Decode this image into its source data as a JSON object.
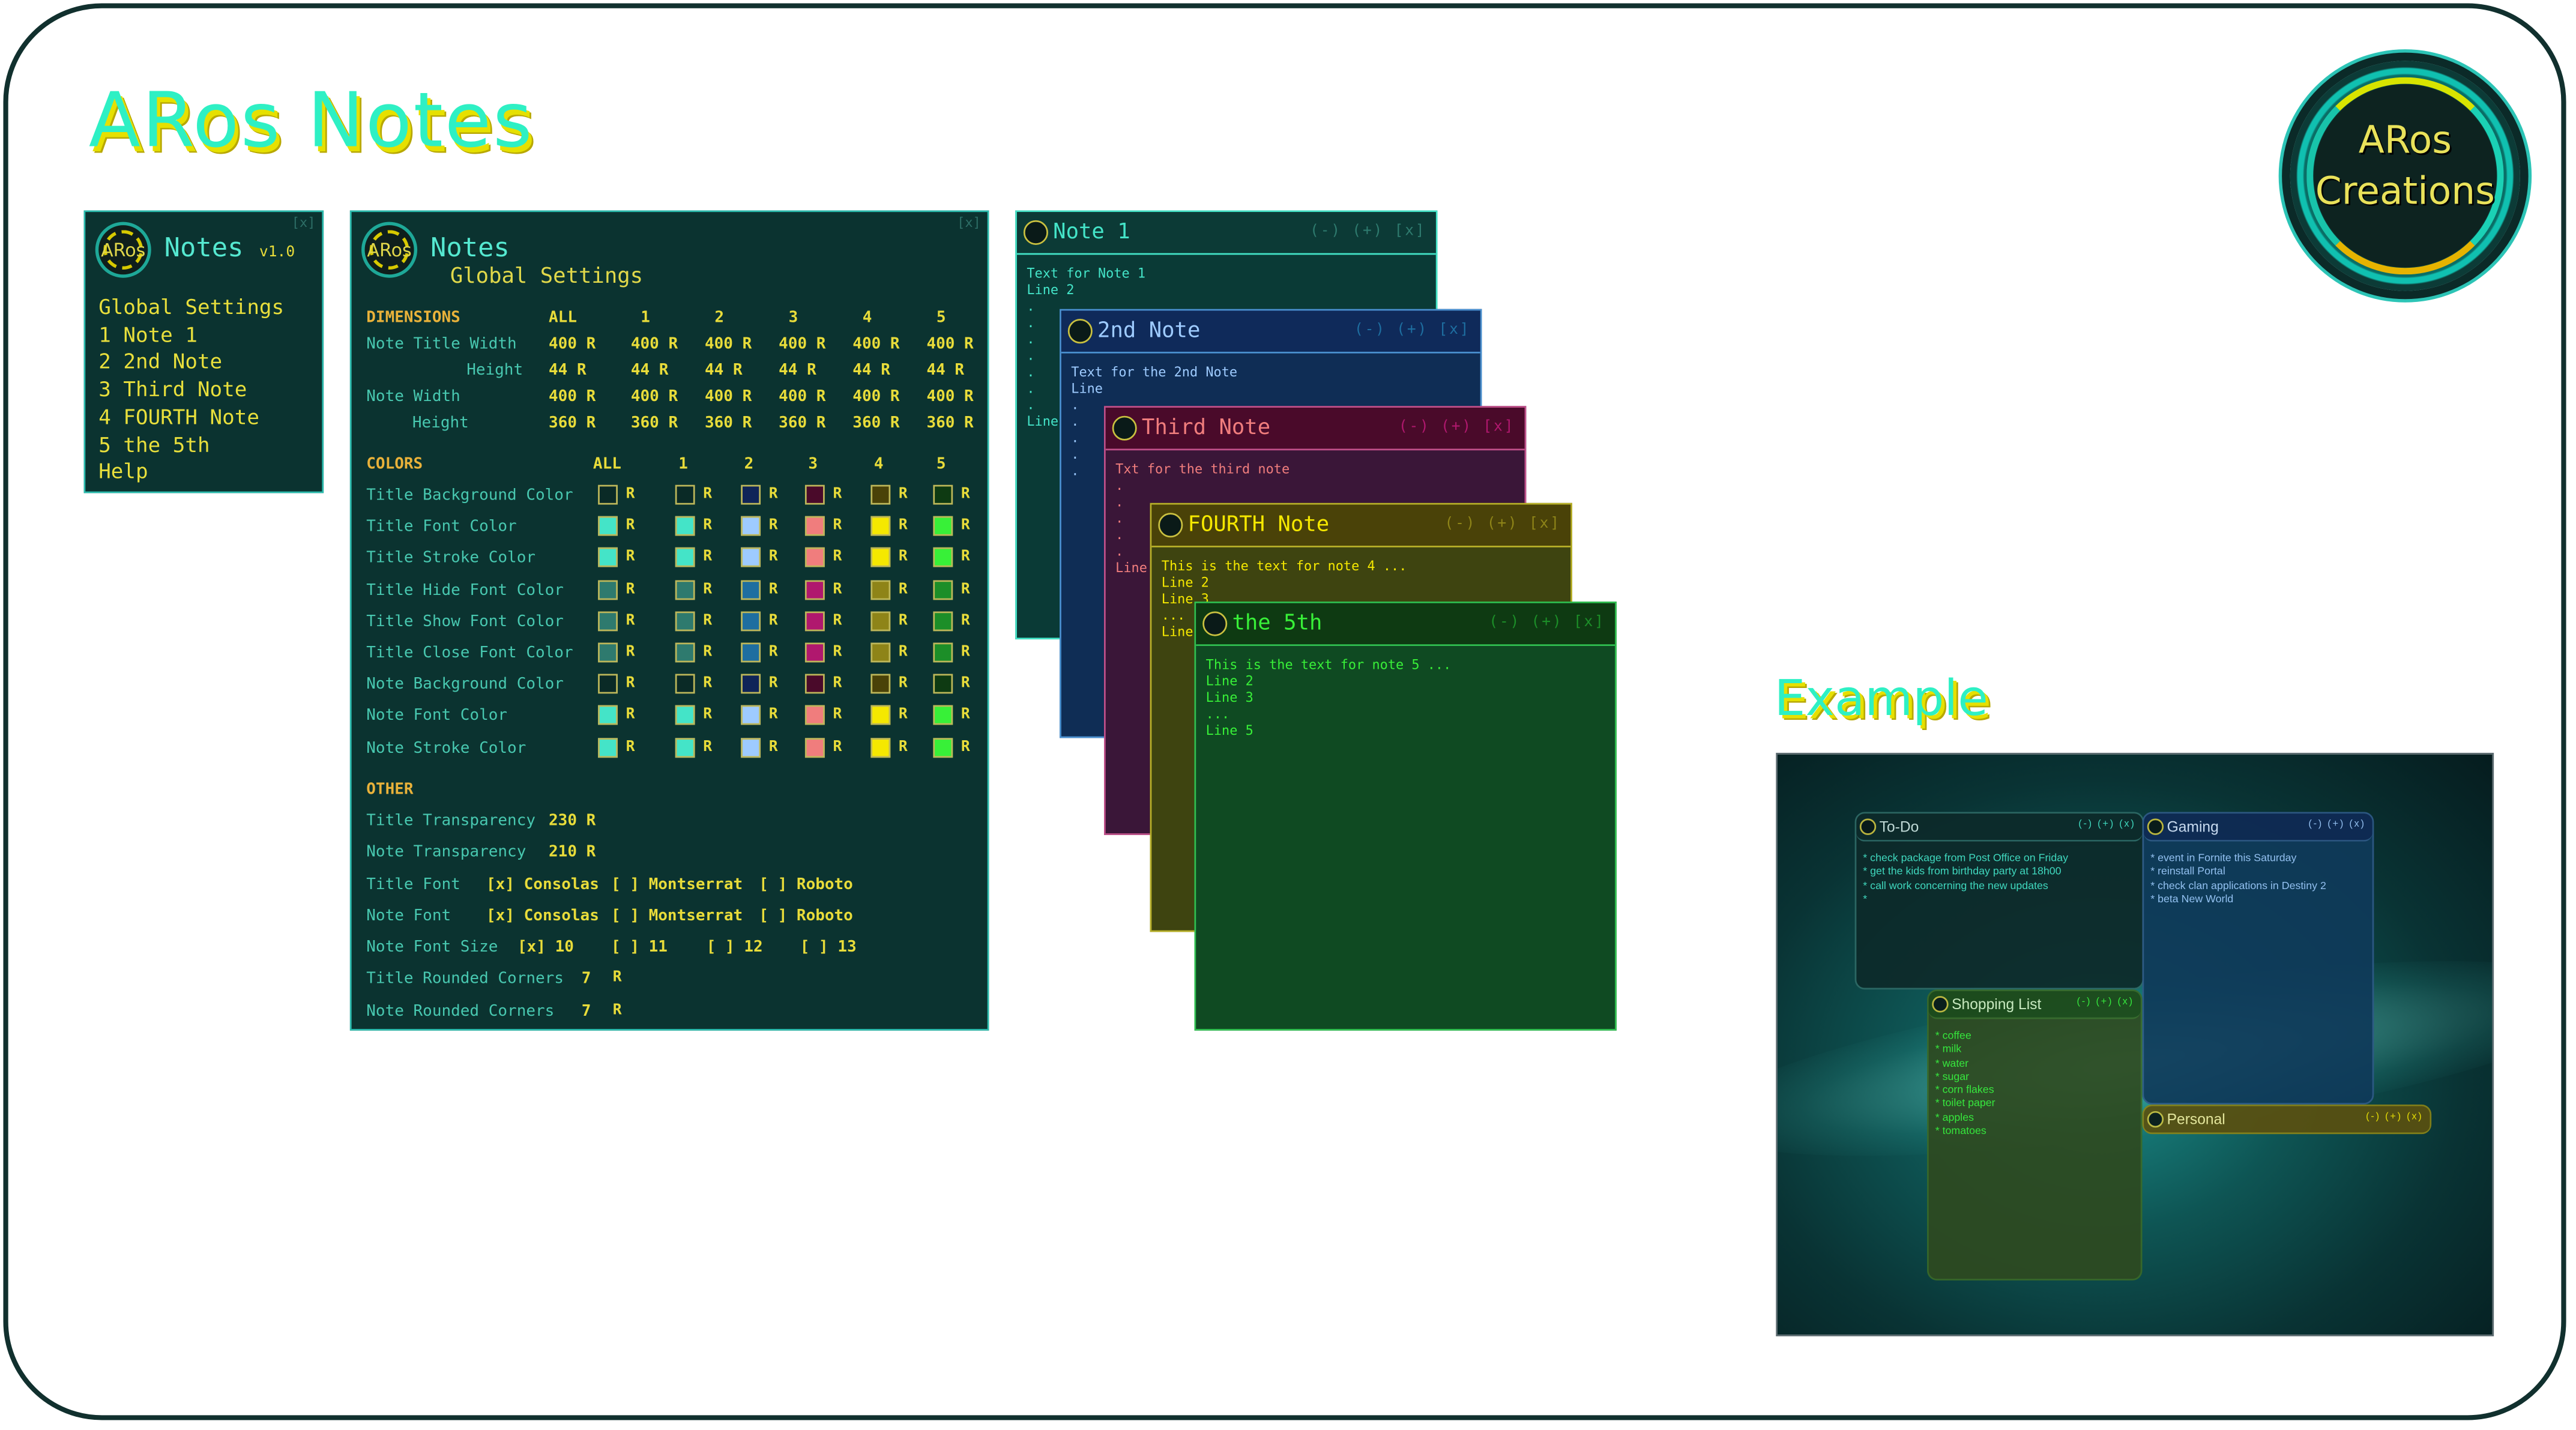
{
  "app_title": "ARos Notes",
  "logo": {
    "line1": "ARos",
    "line2": "Creations"
  },
  "mini_logo_text": "ARos",
  "menu": {
    "title": "Notes",
    "version": "v1.0",
    "close": "[x]",
    "items": [
      "Global Settings",
      "1 Note 1",
      "2 2nd Note",
      "3 Third Note",
      "4 FOURTH Note",
      "5 the 5th",
      "Help"
    ]
  },
  "settings": {
    "title": "Notes",
    "subtitle": "Global Settings",
    "close": "[x]",
    "dimensions": {
      "label": "DIMENSIONS",
      "columns": [
        "ALL",
        "1",
        "2",
        "3",
        "4",
        "5"
      ],
      "rows": [
        {
          "label": "Note Title Width",
          "values": [
            "400 R",
            "400 R",
            "400 R",
            "400 R",
            "400 R",
            "400 R"
          ]
        },
        {
          "label": "Height",
          "values": [
            "44  R",
            "44  R",
            "44  R",
            "44  R",
            "44  R",
            "44  R"
          ]
        },
        {
          "label": "Note Width",
          "values": [
            "400 R",
            "400 R",
            "400 R",
            "400 R",
            "400 R",
            "400 R"
          ]
        },
        {
          "label": "Height",
          "values": [
            "360 R",
            "360 R",
            "360 R",
            "360 R",
            "360 R",
            "360 R"
          ]
        }
      ]
    },
    "colors": {
      "label": "COLORS",
      "columns": [
        "ALL",
        "1",
        "2",
        "3",
        "4",
        "5"
      ],
      "reset": "R",
      "rows": [
        {
          "label": "Title Background Color",
          "swatches": [
            "#0a2a26",
            "#0a2a26",
            "#0f2458",
            "#4a0a2a",
            "#4a4208",
            "#0e3a12"
          ]
        },
        {
          "label": "Title Font Color",
          "swatches": [
            "#44e4c8",
            "#44e4c8",
            "#9ecbff",
            "#f07d7d",
            "#f5e800",
            "#38f038"
          ]
        },
        {
          "label": "Title Stroke Color",
          "swatches": [
            "#44e4c8",
            "#44e4c8",
            "#9ecbff",
            "#f07d7d",
            "#f5e800",
            "#38f038"
          ]
        },
        {
          "label": "Title Hide Font Color",
          "swatches": [
            "#2e7a6e",
            "#2e7a6e",
            "#1e6ea0",
            "#b0186e",
            "#8e8418",
            "#1c8e28"
          ]
        },
        {
          "label": "Title Show Font Color",
          "swatches": [
            "#2e7a6e",
            "#2e7a6e",
            "#1e6ea0",
            "#b0186e",
            "#8e8418",
            "#1c8e28"
          ]
        },
        {
          "label": "Title Close Font Color",
          "swatches": [
            "#2e7a6e",
            "#2e7a6e",
            "#1e6ea0",
            "#b0186e",
            "#8e8418",
            "#1c8e28"
          ]
        },
        {
          "label": "Note Background Color",
          "swatches": [
            "#0a2a26",
            "#0a2a26",
            "#0f2458",
            "#4a0a2a",
            "#4a4208",
            "#0e3a12"
          ]
        },
        {
          "label": "Note Font Color",
          "swatches": [
            "#44e4c8",
            "#44e4c8",
            "#9ecbff",
            "#f07d7d",
            "#f5e800",
            "#38f038"
          ]
        },
        {
          "label": "Note Stroke Color",
          "swatches": [
            "#44e4c8",
            "#44e4c8",
            "#9ecbff",
            "#f07d7d",
            "#f5e800",
            "#38f038"
          ]
        }
      ]
    },
    "other": {
      "label": "OTHER",
      "title_transparency": {
        "label": "Title Transparency",
        "value": "230 R"
      },
      "note_transparency": {
        "label": "Note Transparency",
        "value": "210 R"
      },
      "title_font": {
        "label": "Title Font",
        "options": [
          "[x] Consolas",
          "[ ] Montserrat",
          "[ ] Roboto"
        ]
      },
      "note_font": {
        "label": "Note Font",
        "options": [
          "[x] Consolas",
          "[ ] Montserrat",
          "[ ] Roboto"
        ]
      },
      "note_font_size": {
        "label": "Note Font Size",
        "options": [
          "[x] 10",
          "[ ] 11",
          "[ ] 12",
          "[ ] 13"
        ]
      },
      "title_corners": {
        "label": "Title Rounded Corners",
        "value": "7",
        "reset": "R"
      },
      "note_corners": {
        "label": "Note Rounded Corners",
        "value": "7",
        "reset": "R"
      }
    }
  },
  "notes": [
    {
      "title": "Note 1",
      "controls": "(-) (+) [x]",
      "body": "Text for Note 1\nLine 2\n.\n.\n.\n.\n.\n.\n.\nLine",
      "colors": {
        "bg": "#0a3a36",
        "bar": "#0c3a36",
        "fg": "#44e4c8",
        "stroke": "#44e4c8",
        "ctrl": "#2e7a6e"
      }
    },
    {
      "title": "2nd Note",
      "controls": "(-) (+) [x]",
      "body": "Text for the 2nd Note\nLine\n.\n.\n.\n.\n.",
      "colors": {
        "bg": "#0f2d55",
        "bar": "#0f2a5a",
        "fg": "#9ecbff",
        "stroke": "#4a90d0",
        "ctrl": "#1e6ea0"
      }
    },
    {
      "title": "Third Note",
      "controls": "(-) (+) [x]",
      "body": "Txt for the third note\n.\n.\n.\n.\n.\nLine",
      "colors": {
        "bg": "#3a1638",
        "bar": "#4a0a2a",
        "fg": "#f07d7d",
        "stroke": "#c0508a",
        "ctrl": "#b0186e"
      }
    },
    {
      "title": "FOURTH Note",
      "controls": "(-) (+) [x]",
      "body": "This is the text for note 4 ...\nLine 2\nLine 3\n...\nLine",
      "colors": {
        "bg": "#3e4410",
        "bar": "#4a4208",
        "fg": "#f5e800",
        "stroke": "#b8b028",
        "ctrl": "#8e8418"
      }
    },
    {
      "title": "the 5th",
      "controls": "(-) (+) [x]",
      "body": "This is the text for note 5 ...\nLine 2\nLine 3\n...\nLine 5",
      "colors": {
        "bg": "#0f4a22",
        "bar": "#0e3a12",
        "fg": "#38f038",
        "stroke": "#30c050",
        "ctrl": "#1c8e28"
      }
    }
  ],
  "example_title": "Example",
  "example": [
    {
      "title": "To-Do",
      "body": "* check package from Post Office on Friday\n* get the kids from birthday party at 18h00\n* call work concerning the new updates\n*",
      "colors": {
        "bg": "#0d2a2a",
        "hd": "#0d2a2a",
        "fg": "#44e4c8",
        "stroke": "#2e6a66",
        "tx": "#cfe8e4"
      }
    },
    {
      "title": "Gaming",
      "body": "* event in Fornite this Saturday\n* reinstall Portal\n* check clan applications in Destiny 2\n* beta New World",
      "colors": {
        "bg": "#0f3a5a",
        "hd": "#0f2a55",
        "fg": "#9ecbff",
        "stroke": "#2f5a88",
        "tx": "#d8e8ff"
      }
    },
    {
      "title": "Shopping List",
      "body": "* coffee\n* milk\n* water\n* sugar\n* corn flakes\n* toilet paper\n* apples\n* tomatoes",
      "colors": {
        "bg": "#2e4a20",
        "hd": "#1e4a18",
        "fg": "#38f038",
        "stroke": "#3a6a28",
        "tx": "#d8f5c8"
      }
    },
    {
      "title": "Personal",
      "body": "",
      "colors": {
        "bg": "#4a4a12",
        "hd": "#5a5010",
        "fg": "#f5e800",
        "stroke": "#8a8418",
        "tx": "#f5f0a0"
      }
    }
  ],
  "example_controls": "(-) (+) (x)"
}
